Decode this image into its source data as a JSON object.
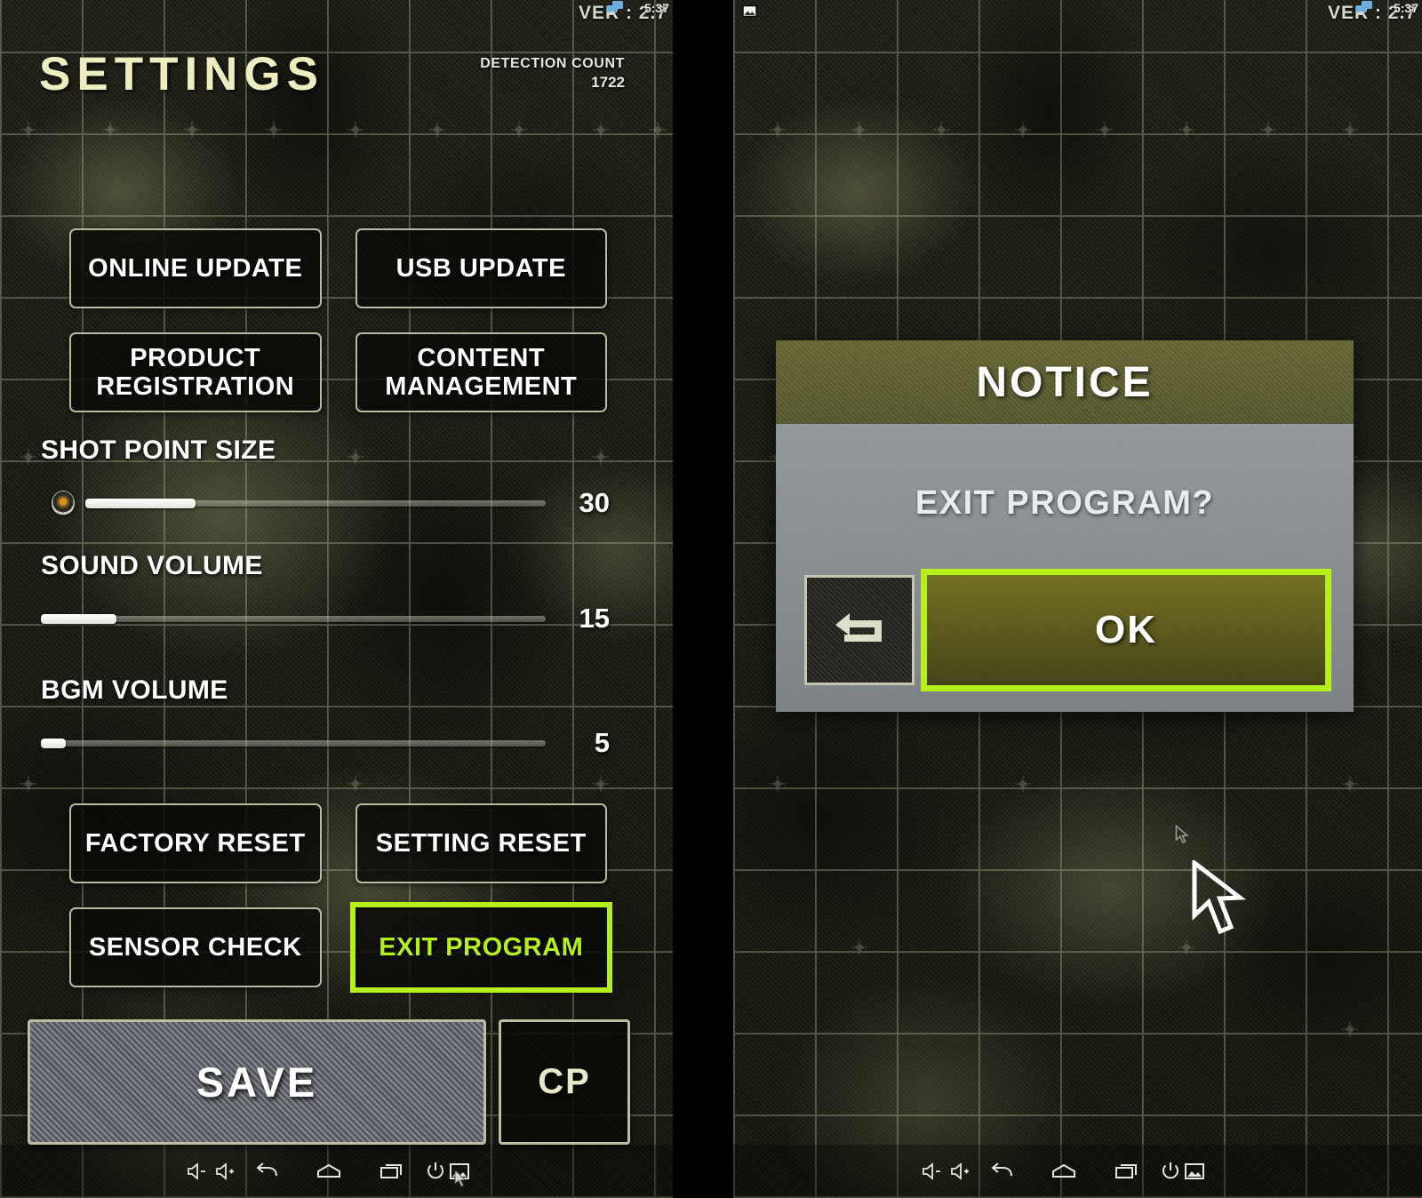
{
  "app": {
    "title": "SETTINGS",
    "accent_green": "#b5f01c",
    "title_color": "#eeedc0",
    "background_color": "#2b2c1c"
  },
  "statusbar": {
    "version_label": "VER : 2.7",
    "time": "5:37",
    "cast_icon": "cast-screen-icon",
    "screenshot_icon": "screenshot-icon"
  },
  "header": {
    "detection_label": "DETECTION COUNT",
    "detection_value": "1722"
  },
  "buttons": {
    "online_update": "ONLINE UPDATE",
    "usb_update": "USB UPDATE",
    "product_registration": "PRODUCT\nREGISTRATION",
    "content_management": "CONTENT\nMANAGEMENT",
    "factory_reset": "FACTORY RESET",
    "setting_reset": "SETTING RESET",
    "sensor_check": "SENSOR CHECK",
    "exit_program": "EXIT PROGRAM",
    "save": "SAVE",
    "cp": "CP"
  },
  "sliders": [
    {
      "label": "SHOT POINT SIZE",
      "value": "30",
      "percent": 24,
      "icon": "bullet-hole-icon",
      "has_icon": true
    },
    {
      "label": "SOUND VOLUME",
      "value": "15",
      "percent": 15,
      "icon": "",
      "has_icon": false
    },
    {
      "label": "BGM VOLUME",
      "value": "5",
      "percent": 5,
      "icon": "",
      "has_icon": false
    }
  ],
  "dialog": {
    "title": "NOTICE",
    "message": "EXIT PROGRAM?",
    "ok_label": "OK",
    "back_icon": "return-arrow-icon",
    "header_color": "#6b6b3a",
    "body_color": "#9b9fa3",
    "ok_highlight_color": "#b5f01c"
  },
  "navbar": {
    "items": [
      {
        "icon": "volume-down-icon"
      },
      {
        "icon": "volume-up-icon"
      },
      {
        "icon": "back-icon"
      },
      {
        "icon": "home-icon"
      },
      {
        "icon": "recents-icon"
      },
      {
        "icon": "power-icon"
      },
      {
        "icon": "screenshot-icon"
      }
    ]
  },
  "annotations": {
    "highlighted_exit_button": "EXIT PROGRAM",
    "highlighted_ok_button": "OK"
  }
}
